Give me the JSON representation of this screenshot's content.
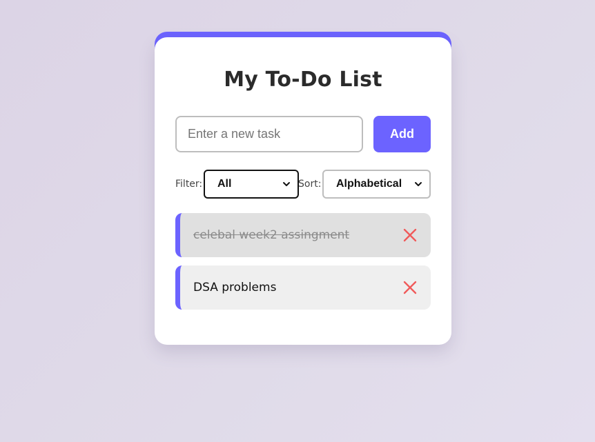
{
  "app": {
    "title": "My To-Do List",
    "accent_color": "#6c63ff",
    "delete_color": "#f05a5a"
  },
  "input": {
    "placeholder": "Enter a new task",
    "value": "",
    "add_label": "Add"
  },
  "controls": {
    "filter_label": "Filter:",
    "filter_value": "All",
    "sort_label": "Sort:",
    "sort_value": "Alphabetical"
  },
  "tasks": [
    {
      "text": "celebal week2 assingment",
      "completed": true,
      "delete_icon": "close-icon"
    },
    {
      "text": "DSA problems",
      "completed": false,
      "delete_icon": "close-icon"
    }
  ]
}
